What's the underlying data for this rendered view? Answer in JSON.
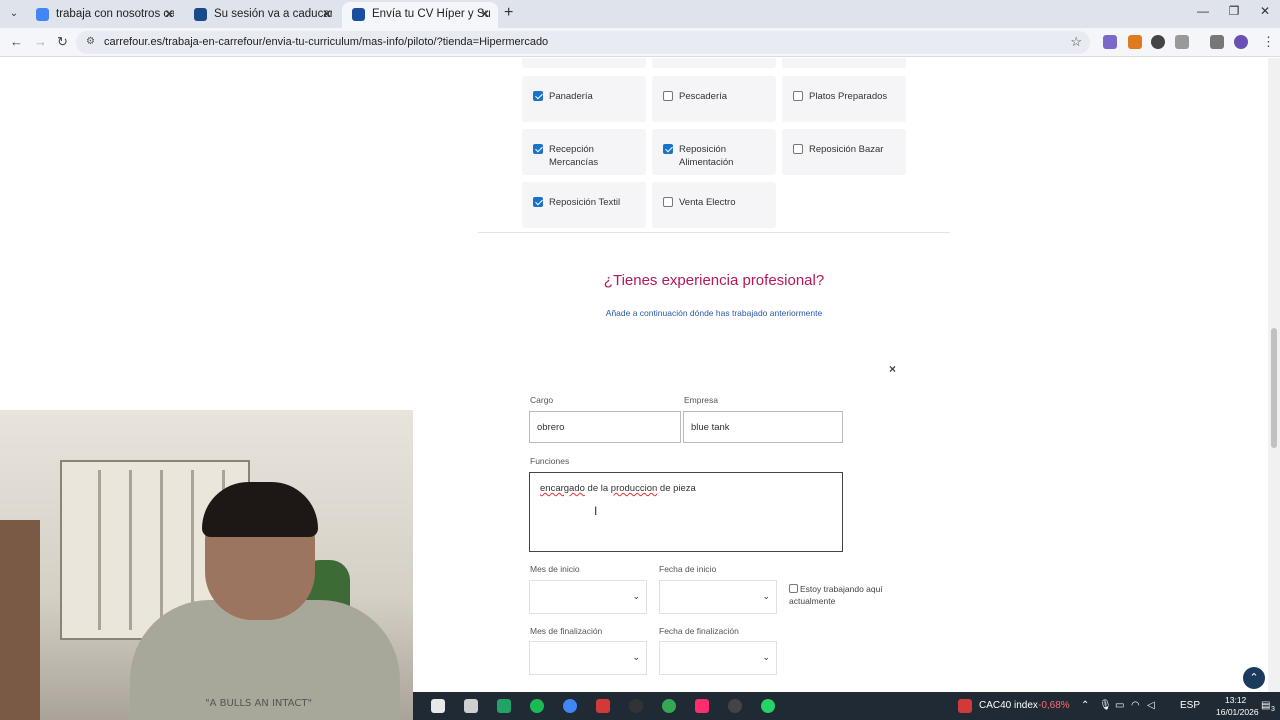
{
  "browser": {
    "tabs": [
      {
        "title": "trabaja con nosotros carrefour -",
        "active": false,
        "favicon_color": "#4285f4"
      },
      {
        "title": "Su sesión va a caducar.",
        "active": false,
        "favicon_color": "#1a4a8a"
      },
      {
        "title": "Envía tu CV Híper y Super - Tra",
        "active": true,
        "favicon_color": "#1a4fa0"
      }
    ],
    "new_tab_label": "+",
    "url": "carrefour.es/trabaja-en-carrefour/envia-tu-curriculum/mas-info/piloto/?tienda=Hipermercado"
  },
  "categories": [
    {
      "label": "Panadería",
      "checked": true
    },
    {
      "label": "Pescadería",
      "checked": false
    },
    {
      "label": "Platos Preparados",
      "checked": false
    },
    {
      "label": "Recepción Mercancías",
      "checked": true
    },
    {
      "label": "Reposición Alimentación",
      "checked": true
    },
    {
      "label": "Reposición Bazar",
      "checked": false
    },
    {
      "label": "Reposición Textil",
      "checked": true
    },
    {
      "label": "Venta Electro",
      "checked": false
    }
  ],
  "experience": {
    "title": "¿Tienes experiencia profesional?",
    "subtitle": "Añade a continuación dónde has trabajado anteriormente",
    "close_icon": "×",
    "cargo_label": "Cargo",
    "cargo_value": "obrero",
    "empresa_label": "Empresa",
    "empresa_value": "blue tank",
    "funciones_label": "Funciones",
    "funciones_word1": "encargado",
    "funciones_mid": " de la ",
    "funciones_word2": "produccion",
    "funciones_end": " de pieza",
    "mes_inicio_label": "Mes de inicio",
    "fecha_inicio_label": "Fecha de inicio",
    "trabajando_label": "Estoy trabajando aquí actualmente",
    "mes_fin_label": "Mes de finalización",
    "fecha_fin_label": "Fecha de finalización"
  },
  "webcam": {
    "shirt_text": "\"A BULLS AN INTACT\""
  },
  "taskbar": {
    "ticker_name": "CAC40 index",
    "ticker_change": "-0,68%",
    "lang": "ESP",
    "time": "13:12",
    "date": "16/01/2026",
    "notif_count": "3"
  }
}
